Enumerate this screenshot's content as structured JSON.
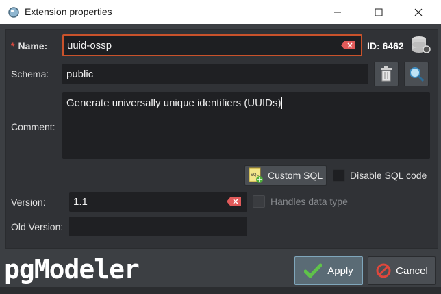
{
  "window": {
    "title": "Extension properties"
  },
  "form": {
    "name_label": "Name:",
    "name_value": "uuid-ossp",
    "id_label": "ID: 6462",
    "schema_label": "Schema:",
    "schema_value": "public",
    "comment_label": "Comment:",
    "comment_value": "Generate universally unique identifiers (UUIDs)",
    "custom_sql_label": "Custom SQL",
    "disable_sql_label": "Disable SQL code",
    "version_label": "Version:",
    "version_value": "1.1",
    "handles_label": "Handles data type",
    "old_version_label": "Old Version:",
    "old_version_value": ""
  },
  "footer": {
    "logo": "pgModeler",
    "apply_prefix": "",
    "apply_hotkey": "A",
    "apply_rest": "pply",
    "cancel_hotkey": "C",
    "cancel_rest": "ancel"
  },
  "colors": {
    "accent_border": "#c9522b",
    "apply_border": "#7fa6bb"
  }
}
